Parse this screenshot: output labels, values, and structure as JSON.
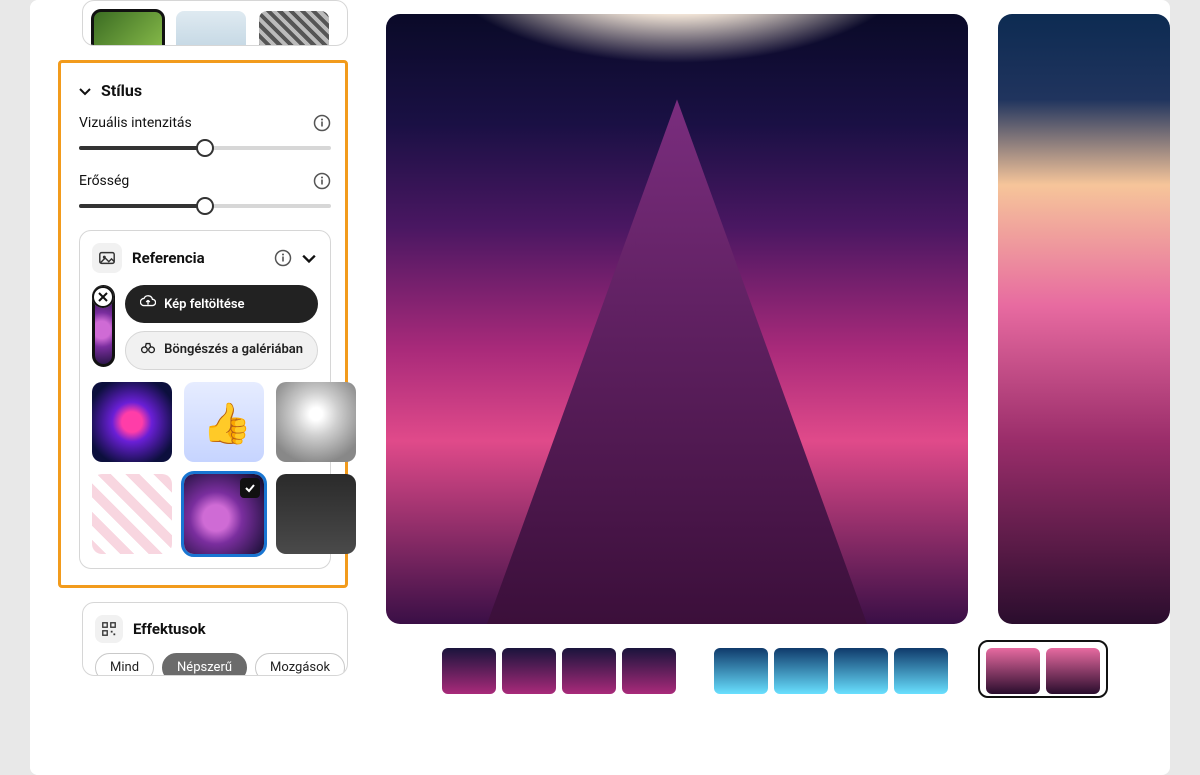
{
  "style_panel": {
    "title": "Stílus",
    "sliders": {
      "visual": {
        "label": "Vizuális intenzitás",
        "value": 50
      },
      "strength": {
        "label": "Erősség",
        "value": 50
      }
    },
    "reference": {
      "title": "Referencia",
      "upload_label": "Kép feltöltése",
      "browse_label": "Böngészés a galériában",
      "thumbs": [
        {
          "id": "neon-portal",
          "selected": false
        },
        {
          "id": "3d-thumbs-up",
          "selected": false
        },
        {
          "id": "statue-sketch",
          "selected": false
        },
        {
          "id": "hands-pattern",
          "selected": false
        },
        {
          "id": "pink-clouds",
          "selected": true
        },
        {
          "id": "photo-man-suit",
          "selected": false
        }
      ]
    }
  },
  "effects_panel": {
    "title": "Effektusok",
    "tabs": {
      "all": "Mind",
      "popular": "Népszerű",
      "movements": "Mozgások"
    },
    "active_tab": "popular"
  },
  "results": {
    "images": [
      {
        "id": "spaceship-over-pink-clouds"
      },
      {
        "id": "pink-sunset-clouds"
      }
    ],
    "variation_sets": [
      {
        "selected": false
      },
      {
        "selected": false
      },
      {
        "selected": true
      }
    ]
  }
}
